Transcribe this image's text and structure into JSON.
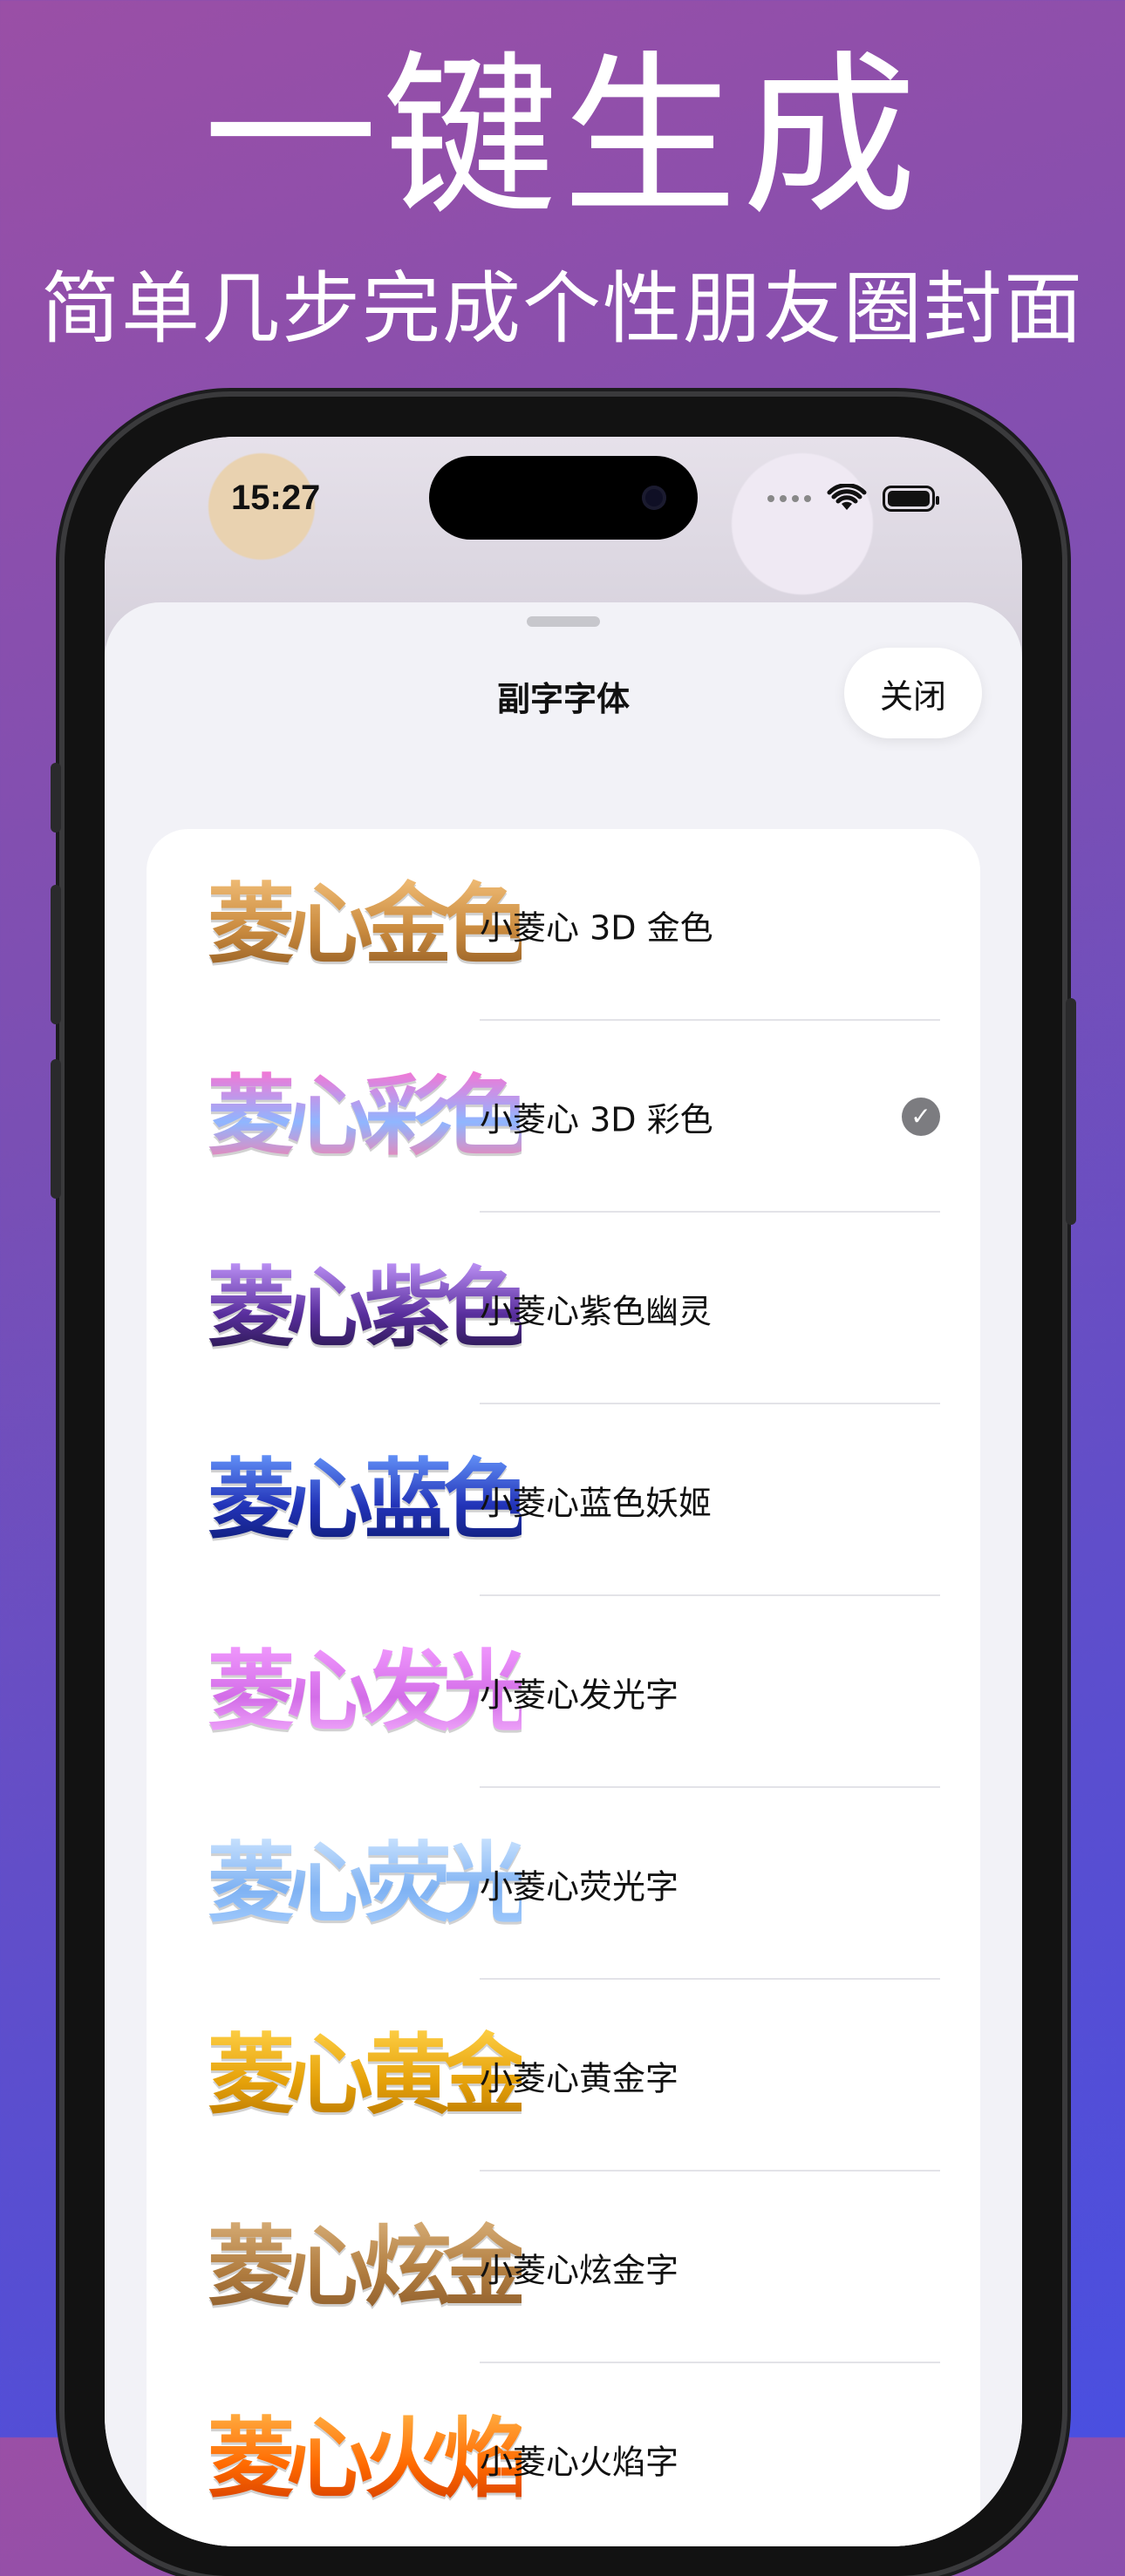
{
  "promo": {
    "headline": "一键生成",
    "subheadline": "简单几步完成个性朋友圈封面"
  },
  "status_bar": {
    "time": "15:27"
  },
  "sheet": {
    "title": "副字字体",
    "close_label": "关闭"
  },
  "fonts": [
    {
      "preview": "菱心金色",
      "label": "小菱心 3D 金色",
      "selected": false,
      "colors": [
        "#f3c07a",
        "#c98a3e",
        "#8f5a22"
      ]
    },
    {
      "preview": "菱心彩色",
      "label": "小菱心 3D 彩色",
      "selected": true,
      "colors": [
        "#ff6fcf",
        "#8fb6ff",
        "#ff7aa6"
      ]
    },
    {
      "preview": "菱心紫色",
      "label": "小菱心紫色幽灵",
      "selected": false,
      "colors": [
        "#c79cff",
        "#5a2f9e",
        "#1f1340"
      ]
    },
    {
      "preview": "菱心蓝色",
      "label": "小菱心蓝色妖姬",
      "selected": false,
      "colors": [
        "#6a9cff",
        "#2233b8",
        "#0d1a6e"
      ]
    },
    {
      "preview": "菱心发光",
      "label": "小菱心发光字",
      "selected": false,
      "colors": [
        "#f39cff",
        "#d36de8",
        "#f7b6ff"
      ]
    },
    {
      "preview": "菱心荧光",
      "label": "小菱心荧光字",
      "selected": false,
      "colors": [
        "#cfe6ff",
        "#7fb2f3",
        "#a9d0ff"
      ]
    },
    {
      "preview": "菱心黄金",
      "label": "小菱心黄金字",
      "selected": false,
      "colors": [
        "#ffd24a",
        "#e6a20a",
        "#b57400"
      ]
    },
    {
      "preview": "菱心炫金",
      "label": "小菱心炫金字",
      "selected": false,
      "colors": [
        "#d9b07a",
        "#b07c3f",
        "#8a5a2a"
      ]
    },
    {
      "preview": "菱心火焰",
      "label": "小菱心火焰字",
      "selected": false,
      "colors": [
        "#ffb347",
        "#ff6a00",
        "#d13a00"
      ]
    }
  ]
}
